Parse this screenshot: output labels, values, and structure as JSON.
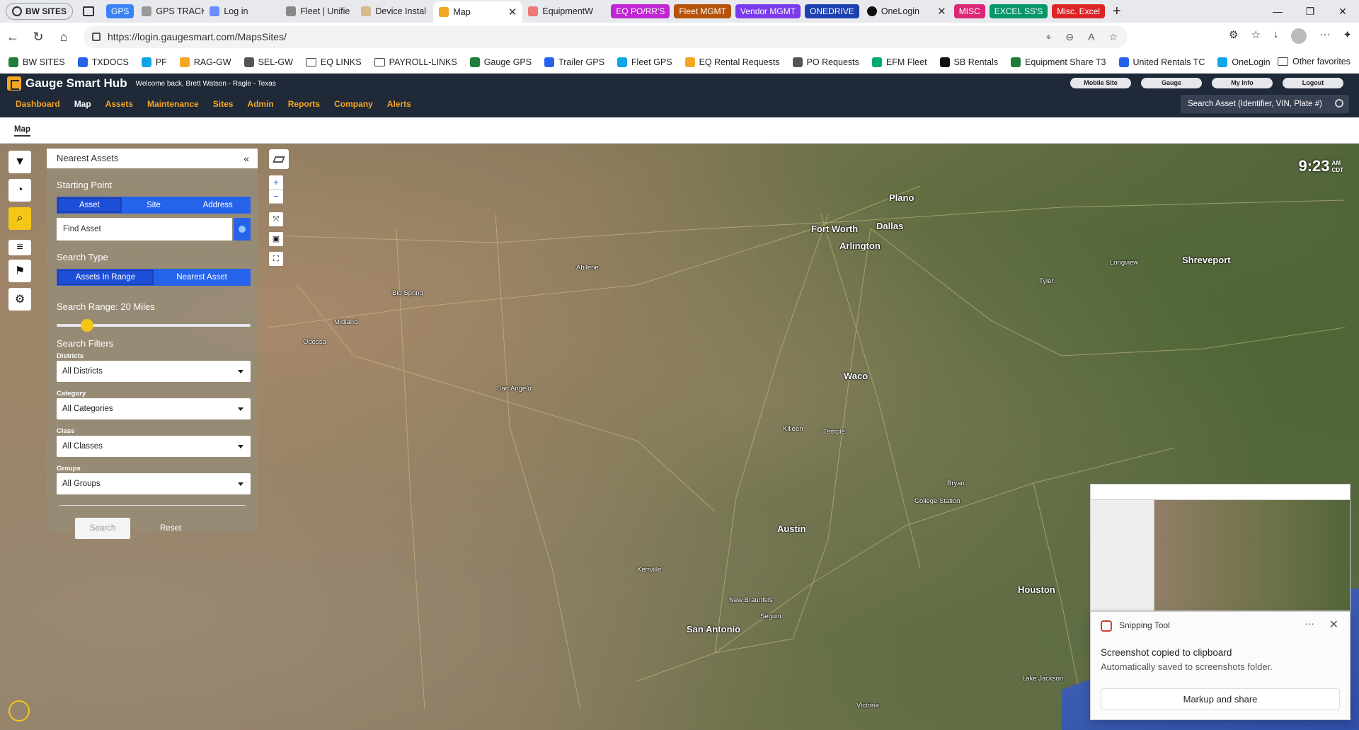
{
  "browser": {
    "profile_label": "BW SITES",
    "tabs": [
      {
        "label": "GPS",
        "group": true,
        "color": "#3b82f6"
      },
      {
        "label": "GPS TRACKIN",
        "fav": "#999"
      },
      {
        "label": "Log in",
        "fav": "#6b8cff"
      },
      {
        "label": "Fleet | Unifie",
        "fav": "#888"
      },
      {
        "label": "Device Instal",
        "fav": "#d6b98c"
      },
      {
        "label": "Map",
        "fav": "#f5a623",
        "active": true
      },
      {
        "label": "EquipmentW",
        "fav": "#e77"
      }
    ],
    "groups": [
      {
        "label": "EQ PO/RR'S",
        "color": "#c026d3"
      },
      {
        "label": "Fleet MGMT",
        "color": "#b45309"
      },
      {
        "label": "Vendor MGMT",
        "color": "#7c3aed"
      },
      {
        "label": "ONEDRIVE",
        "color": "#1e40af"
      }
    ],
    "onelogin_tab": "OneLogin",
    "groups2": [
      {
        "label": "MISC",
        "color": "#db2777"
      },
      {
        "label": "EXCEL SS'S",
        "color": "#059669"
      },
      {
        "label": "Misc. Excel",
        "color": "#dc2626"
      }
    ],
    "url": "https://login.gaugesmart.com/MapsSites/",
    "favorites": [
      {
        "label": "BW SITES",
        "icon": "globe-icon"
      },
      {
        "label": "TXDOCS",
        "icon": "link-icon"
      },
      {
        "label": "PF",
        "icon": "link-icon"
      },
      {
        "label": "RAG-GW",
        "icon": "g-icon"
      },
      {
        "label": "SEL-GW",
        "icon": "g-icon"
      },
      {
        "label": "EQ LINKS",
        "icon": "folder-icon"
      },
      {
        "label": "PAYROLL-LINKS",
        "icon": "folder-icon"
      },
      {
        "label": "Gauge GPS",
        "icon": "gauge-icon"
      },
      {
        "label": "Trailer GPS",
        "icon": "globe-icon"
      },
      {
        "label": "Fleet GPS",
        "icon": "globe-icon"
      },
      {
        "label": "EQ Rental Requests",
        "icon": "globe-icon"
      },
      {
        "label": "PO Requests",
        "icon": "check-icon"
      },
      {
        "label": "EFM Fleet",
        "icon": "e-icon"
      },
      {
        "label": "SB Rentals",
        "icon": "gear-icon"
      },
      {
        "label": "Equipment Share T3",
        "icon": "globe-icon"
      },
      {
        "label": "United Rentals TC",
        "icon": "globe-icon"
      },
      {
        "label": "OneLogin",
        "icon": "onelogin-icon"
      }
    ],
    "other_favorites": "Other favorites"
  },
  "app": {
    "name": "Gauge Smart Hub",
    "welcome": "Welcome back, Brett Watson - Ragle - Texas",
    "top_buttons": [
      "Mobile Site",
      "Gauge",
      "My Info",
      "Logout"
    ],
    "nav": [
      "Dashboard",
      "Map",
      "Assets",
      "Maintenance",
      "Sites",
      "Admin",
      "Reports",
      "Company",
      "Alerts"
    ],
    "active_nav": "Map",
    "search_placeholder": "Search Asset (Identifier, VIN, Plate #)",
    "sub_tab": "Map"
  },
  "panel": {
    "title": "Nearest Assets",
    "collapse": "«",
    "starting_point_label": "Starting Point",
    "starting_point_options": [
      "Asset",
      "Site",
      "Address"
    ],
    "find_asset_placeholder": "Find Asset",
    "search_type_label": "Search Type",
    "search_type_options": [
      "Assets In Range",
      "Nearest Asset"
    ],
    "range_label": "Search Range: 20 Miles",
    "range_value": 20,
    "filters_label": "Search Filters",
    "districts_label": "Districts",
    "districts_value": "All Districts",
    "category_label": "Category",
    "category_value": "All Categories",
    "class_label": "Class",
    "class_value": "All Classes",
    "groups_label": "Groups",
    "groups_value": "All Groups",
    "search_button": "Search",
    "reset_button": "Reset"
  },
  "map": {
    "clock_time": "9:23",
    "clock_ampm": "AM",
    "clock_tz": "CDT",
    "cities": [
      {
        "name": "Fort Worth",
        "big": true
      },
      {
        "name": "Dallas",
        "big": true
      },
      {
        "name": "Arlington",
        "big": true
      },
      {
        "name": "Plano",
        "big": true
      },
      {
        "name": "Waco",
        "big": true
      },
      {
        "name": "Austin",
        "big": true
      },
      {
        "name": "San Antonio",
        "big": true
      },
      {
        "name": "Houston",
        "big": true
      },
      {
        "name": "Shreveport",
        "big": true
      },
      {
        "name": "Abilene"
      },
      {
        "name": "Odessa"
      },
      {
        "name": "Midland"
      },
      {
        "name": "Big Spring"
      },
      {
        "name": "San Angelo"
      },
      {
        "name": "Killeen"
      },
      {
        "name": "Temple"
      },
      {
        "name": "Bryan"
      },
      {
        "name": "College Station"
      },
      {
        "name": "Tyler"
      },
      {
        "name": "Longview"
      },
      {
        "name": "Kerrville"
      },
      {
        "name": "New Braunfels"
      },
      {
        "name": "Seguin"
      },
      {
        "name": "Lake Jackson"
      },
      {
        "name": "Victoria"
      }
    ],
    "zoom_in": "+",
    "zoom_out": "−"
  },
  "toast": {
    "app": "Snipping Tool",
    "more": "···",
    "close": "✕",
    "message": "Screenshot copied to clipboard",
    "sub": "Automatically saved to screenshots folder.",
    "action": "Markup and share"
  }
}
